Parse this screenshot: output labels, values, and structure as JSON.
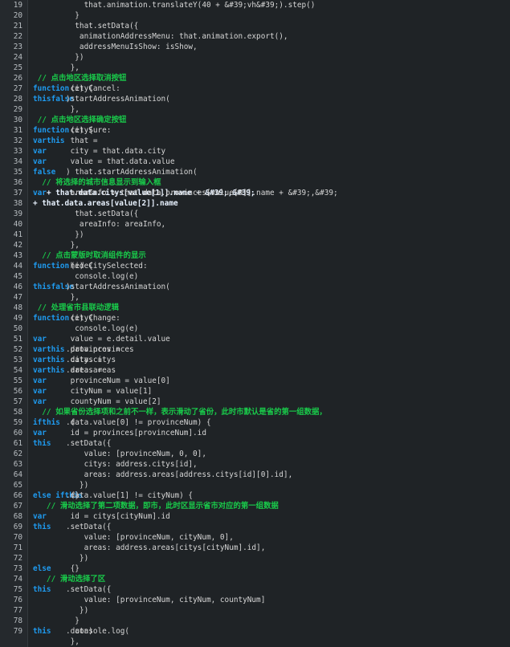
{
  "editor": {
    "lines": [
      {
        "n": "19",
        "segs": [
          {
            "t": "    that.animation.translateY(40 + &#39;vh&#39;).step()",
            "c": "code"
          }
        ]
      },
      {
        "n": "20",
        "segs": [
          {
            "t": "  }",
            "c": "code"
          }
        ]
      },
      {
        "n": "21",
        "segs": [
          {
            "t": "  that.setData({",
            "c": "code"
          }
        ]
      },
      {
        "n": "22",
        "segs": [
          {
            "t": "   animationAddressMenu: that.animation.export(),",
            "c": "code"
          }
        ]
      },
      {
        "n": "23",
        "segs": [
          {
            "t": "   addressMenuIsShow: isShow,",
            "c": "code"
          }
        ]
      },
      {
        "n": "24",
        "segs": [
          {
            "t": "  })",
            "c": "code"
          }
        ]
      },
      {
        "n": "25",
        "segs": [
          {
            "t": " },",
            "c": "code"
          }
        ]
      },
      {
        "n": "26",
        "segs": [
          {
            "t": " // 点击地区选择取消按钮",
            "c": "cm"
          }
        ]
      },
      {
        "n": "27",
        "segs": [
          {
            "t": " cityCancel: ",
            "c": "code"
          },
          {
            "t": "function",
            "c": "kw"
          },
          {
            "t": " (e) {",
            "c": "code"
          }
        ]
      },
      {
        "n": "28",
        "segs": [
          {
            "t": "  ",
            "c": "code"
          },
          {
            "t": "this",
            "c": "kw"
          },
          {
            "t": ".startAddressAnimation(",
            "c": "code"
          },
          {
            "t": "false",
            "c": "kw"
          },
          {
            "t": ")",
            "c": "code"
          }
        ]
      },
      {
        "n": "29",
        "segs": [
          {
            "t": " },",
            "c": "code"
          }
        ]
      },
      {
        "n": "30",
        "segs": [
          {
            "t": " // 点击地区选择确定按钮",
            "c": "cm"
          }
        ]
      },
      {
        "n": "31",
        "segs": [
          {
            "t": " citySure: ",
            "c": "code"
          },
          {
            "t": "function",
            "c": "kw"
          },
          {
            "t": " (e) {",
            "c": "code"
          }
        ]
      },
      {
        "n": "32",
        "segs": [
          {
            "t": "  ",
            "c": "code"
          },
          {
            "t": "var",
            "c": "kw"
          },
          {
            "t": " that = ",
            "c": "code"
          },
          {
            "t": "this",
            "c": "kw"
          }
        ]
      },
      {
        "n": "33",
        "segs": [
          {
            "t": "  ",
            "c": "code"
          },
          {
            "t": "var",
            "c": "kw"
          },
          {
            "t": " city = that.data.city",
            "c": "code"
          }
        ]
      },
      {
        "n": "34",
        "segs": [
          {
            "t": "  ",
            "c": "code"
          },
          {
            "t": "var",
            "c": "kw"
          },
          {
            "t": " value = that.data.value",
            "c": "code"
          }
        ]
      },
      {
        "n": "35",
        "segs": [
          {
            "t": "  that.startAddressAnimation(",
            "c": "code"
          },
          {
            "t": "false",
            "c": "kw"
          },
          {
            "t": ")",
            "c": "code"
          }
        ]
      },
      {
        "n": "36",
        "segs": [
          {
            "t": "  // 将选择的城市信息显示到输入框",
            "c": "cm"
          }
        ]
      },
      {
        "n": "37",
        "segs": [
          {
            "t": "  ",
            "c": "code"
          },
          {
            "t": "var",
            "c": "kw"
          },
          {
            "t": " areaInfo = that.data.provinces[value[0]].name + &#39;,&#39; ",
            "c": "code"
          },
          {
            "t": "+ that.data.citys[value[1]].name + &#39;,&#39;",
            "c": "hl"
          }
        ]
      },
      {
        "n": "38",
        "segs": [
          {
            "t": "+ that.data.areas[value[2]].name",
            "c": "hl"
          }
        ]
      },
      {
        "n": "39",
        "segs": [
          {
            "t": "  that.setData({",
            "c": "code"
          }
        ]
      },
      {
        "n": "40",
        "segs": [
          {
            "t": "   areaInfo: areaInfo,",
            "c": "code"
          }
        ]
      },
      {
        "n": "41",
        "segs": [
          {
            "t": "  })",
            "c": "code"
          }
        ]
      },
      {
        "n": "42",
        "segs": [
          {
            "t": " },",
            "c": "code"
          }
        ]
      },
      {
        "n": "43",
        "segs": [
          {
            "t": "  // 点击蒙版时取消组件的显示",
            "c": "cm"
          }
        ]
      },
      {
        "n": "44",
        "segs": [
          {
            "t": " hideCitySelected: ",
            "c": "code"
          },
          {
            "t": "function",
            "c": "kw"
          },
          {
            "t": " (e) {",
            "c": "code"
          }
        ]
      },
      {
        "n": "45",
        "segs": [
          {
            "t": "  console.log(e)",
            "c": "code"
          }
        ]
      },
      {
        "n": "46",
        "segs": [
          {
            "t": "  ",
            "c": "code"
          },
          {
            "t": "this",
            "c": "kw"
          },
          {
            "t": ".startAddressAnimation(",
            "c": "code"
          },
          {
            "t": "false",
            "c": "kw"
          },
          {
            "t": ")",
            "c": "code"
          }
        ]
      },
      {
        "n": "47",
        "segs": [
          {
            "t": " },",
            "c": "code"
          }
        ]
      },
      {
        "n": "48",
        "segs": [
          {
            "t": " // 处理省市县联动逻辑",
            "c": "cm"
          }
        ]
      },
      {
        "n": "49",
        "segs": [
          {
            "t": " cityChange: ",
            "c": "code"
          },
          {
            "t": "function",
            "c": "kw"
          },
          {
            "t": " (e) {",
            "c": "code"
          }
        ]
      },
      {
        "n": "50",
        "segs": [
          {
            "t": "  console.log(e)",
            "c": "code"
          }
        ]
      },
      {
        "n": "51",
        "segs": [
          {
            "t": "  ",
            "c": "code"
          },
          {
            "t": "var",
            "c": "kw"
          },
          {
            "t": " value = e.detail.value",
            "c": "code"
          }
        ]
      },
      {
        "n": "52",
        "segs": [
          {
            "t": "  ",
            "c": "code"
          },
          {
            "t": "var",
            "c": "kw"
          },
          {
            "t": " provinces = ",
            "c": "code"
          },
          {
            "t": "this",
            "c": "kw"
          },
          {
            "t": ".data.provinces",
            "c": "code"
          }
        ]
      },
      {
        "n": "53",
        "segs": [
          {
            "t": "  ",
            "c": "code"
          },
          {
            "t": "var",
            "c": "kw"
          },
          {
            "t": " citys = ",
            "c": "code"
          },
          {
            "t": "this",
            "c": "kw"
          },
          {
            "t": ".data.citys",
            "c": "code"
          }
        ]
      },
      {
        "n": "54",
        "segs": [
          {
            "t": "  ",
            "c": "code"
          },
          {
            "t": "var",
            "c": "kw"
          },
          {
            "t": " areas = ",
            "c": "code"
          },
          {
            "t": "this",
            "c": "kw"
          },
          {
            "t": ".data.areas",
            "c": "code"
          }
        ]
      },
      {
        "n": "55",
        "segs": [
          {
            "t": "  ",
            "c": "code"
          },
          {
            "t": "var",
            "c": "kw"
          },
          {
            "t": " provinceNum = value[0]",
            "c": "code"
          }
        ]
      },
      {
        "n": "56",
        "segs": [
          {
            "t": "  ",
            "c": "code"
          },
          {
            "t": "var",
            "c": "kw"
          },
          {
            "t": " cityNum = value[1]",
            "c": "code"
          }
        ]
      },
      {
        "n": "57",
        "segs": [
          {
            "t": "  ",
            "c": "code"
          },
          {
            "t": "var",
            "c": "kw"
          },
          {
            "t": " countyNum = value[2]",
            "c": "code"
          }
        ]
      },
      {
        "n": "58",
        "segs": [
          {
            "t": "  // 如果省份选择项和之前不一样，表示滑动了省份，此时市默认是省的第一组数据，",
            "c": "cm"
          }
        ]
      },
      {
        "n": "59",
        "segs": [
          {
            "t": "  ",
            "c": "code"
          },
          {
            "t": "if",
            "c": "kw"
          },
          {
            "t": " (",
            "c": "code"
          },
          {
            "t": "this",
            "c": "kw"
          },
          {
            "t": ".data.value[0] != provinceNum) {",
            "c": "code"
          }
        ]
      },
      {
        "n": "60",
        "segs": [
          {
            "t": "   ",
            "c": "code"
          },
          {
            "t": "var",
            "c": "kw"
          },
          {
            "t": " id = provinces[provinceNum].id",
            "c": "code"
          }
        ]
      },
      {
        "n": "61",
        "segs": [
          {
            "t": "   ",
            "c": "code"
          },
          {
            "t": "this",
            "c": "kw"
          },
          {
            "t": ".setData({",
            "c": "code"
          }
        ]
      },
      {
        "n": "62",
        "segs": [
          {
            "t": "    value: [provinceNum, 0, 0],",
            "c": "code"
          }
        ]
      },
      {
        "n": "63",
        "segs": [
          {
            "t": "    citys: address.citys[id],",
            "c": "code"
          }
        ]
      },
      {
        "n": "64",
        "segs": [
          {
            "t": "    areas: address.areas[address.citys[id][0].id],",
            "c": "code"
          }
        ]
      },
      {
        "n": "65",
        "segs": [
          {
            "t": "   })",
            "c": "code"
          }
        ]
      },
      {
        "n": "66",
        "segs": [
          {
            "t": "  } ",
            "c": "code"
          },
          {
            "t": "else if",
            "c": "kw"
          },
          {
            "t": " (",
            "c": "code"
          },
          {
            "t": "this",
            "c": "kw"
          },
          {
            "t": ".data.value[1] != cityNum) {",
            "c": "code"
          }
        ]
      },
      {
        "n": "67",
        "segs": [
          {
            "t": "   // 滑动选择了第二项数据，即市，此时区显示省市对应的第一组数据",
            "c": "cm"
          }
        ]
      },
      {
        "n": "68",
        "segs": [
          {
            "t": "   ",
            "c": "code"
          },
          {
            "t": "var",
            "c": "kw"
          },
          {
            "t": " id = citys[cityNum].id",
            "c": "code"
          }
        ]
      },
      {
        "n": "69",
        "segs": [
          {
            "t": "   ",
            "c": "code"
          },
          {
            "t": "this",
            "c": "kw"
          },
          {
            "t": ".setData({",
            "c": "code"
          }
        ]
      },
      {
        "n": "70",
        "segs": [
          {
            "t": "    value: [provinceNum, cityNum, 0],",
            "c": "code"
          }
        ]
      },
      {
        "n": "71",
        "segs": [
          {
            "t": "    areas: address.areas[citys[cityNum].id],",
            "c": "code"
          }
        ]
      },
      {
        "n": "72",
        "segs": [
          {
            "t": "   })",
            "c": "code"
          }
        ]
      },
      {
        "n": "73",
        "segs": [
          {
            "t": "  } ",
            "c": "code"
          },
          {
            "t": "else",
            "c": "kw"
          },
          {
            "t": " {",
            "c": "code"
          }
        ]
      },
      {
        "n": "74",
        "segs": [
          {
            "t": "   // 滑动选择了区",
            "c": "cm"
          }
        ]
      },
      {
        "n": "75",
        "segs": [
          {
            "t": "   ",
            "c": "code"
          },
          {
            "t": "this",
            "c": "kw"
          },
          {
            "t": ".setData({",
            "c": "code"
          }
        ]
      },
      {
        "n": "76",
        "segs": [
          {
            "t": "    value: [provinceNum, cityNum, countyNum]",
            "c": "code"
          }
        ]
      },
      {
        "n": "77",
        "segs": [
          {
            "t": "   })",
            "c": "code"
          }
        ]
      },
      {
        "n": "78",
        "segs": [
          {
            "t": "  }",
            "c": "code"
          }
        ]
      },
      {
        "n": "79",
        "segs": [
          {
            "t": "  console.log(",
            "c": "code"
          },
          {
            "t": "this",
            "c": "kw"
          },
          {
            "t": ".data)",
            "c": "code"
          }
        ]
      },
      {
        "n": "",
        "segs": [
          {
            "t": " },",
            "c": "code"
          }
        ]
      }
    ]
  },
  "colors": {
    "background": "#1f2326",
    "gutter": "#25292d",
    "keyword": "#1f9bf0",
    "comment": "#19c94a",
    "text": "#d6d6d6"
  }
}
